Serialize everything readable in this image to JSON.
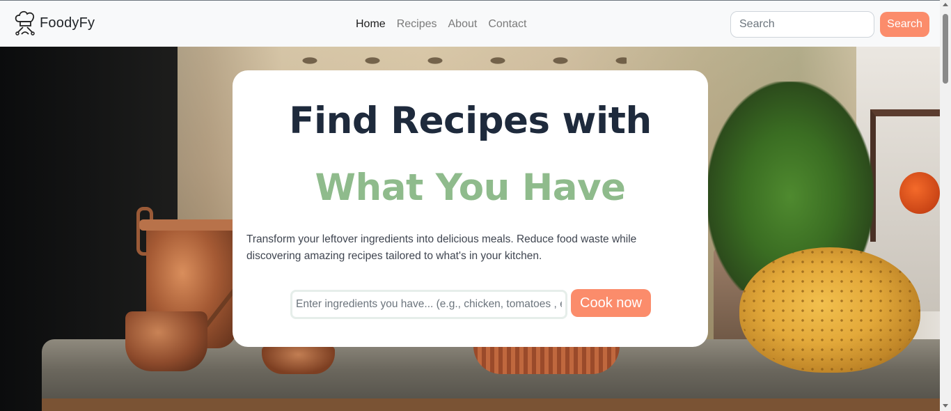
{
  "navbar": {
    "brand": "FoodyFy",
    "logo_icon": "chef-hat-icon",
    "links": [
      {
        "label": "Home",
        "active": true
      },
      {
        "label": "Recipes",
        "active": false
      },
      {
        "label": "About",
        "active": false
      },
      {
        "label": "Contact",
        "active": false
      }
    ],
    "search_placeholder": "Search",
    "search_button": "Search"
  },
  "hero": {
    "title_line1": "Find Recipes with",
    "title_line2": "What You Have",
    "description": "Transform your leftover ingredients into delicious meals. Reduce food waste while discovering amazing recipes tailored to what's in your kitchen.",
    "ingredients_placeholder": "Enter ingredients you have... (e.g., chicken, tomatoes , eggs)",
    "cook_button": "Cook now"
  },
  "colors": {
    "accent": "#fb8c6b",
    "title": "#1e2a3c",
    "title_accent": "#8fbb8c"
  }
}
